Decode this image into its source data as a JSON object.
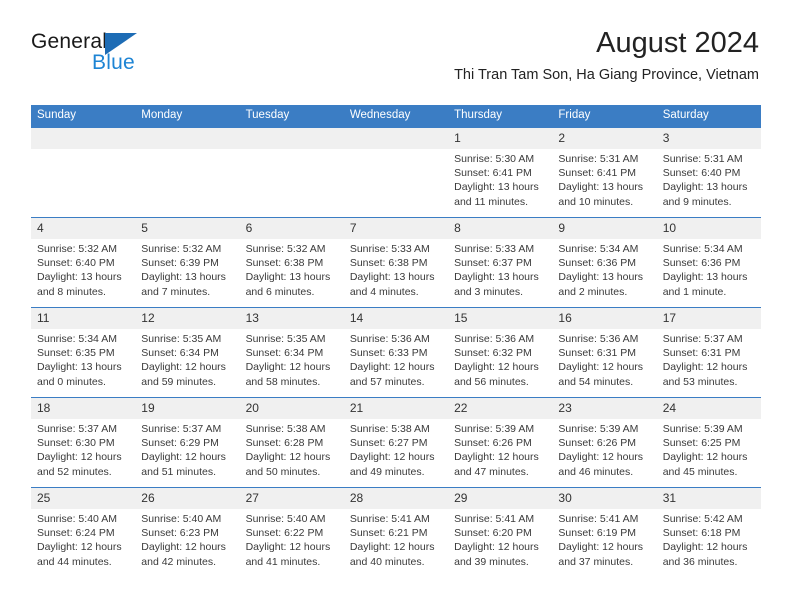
{
  "logo": {
    "primary_text": "General",
    "secondary_text": "Blue",
    "triangle_color": "#1d6cb5",
    "secondary_color": "#1d84d4"
  },
  "header": {
    "title": "August 2024",
    "subtitle": "Thi Tran Tam Son, Ha Giang Province, Vietnam"
  },
  "theme": {
    "header_bar_color": "#3b7dc4",
    "date_band_color": "#f0f0f0",
    "text_color": "#3a3a3a"
  },
  "weekdays": [
    "Sunday",
    "Monday",
    "Tuesday",
    "Wednesday",
    "Thursday",
    "Friday",
    "Saturday"
  ],
  "weeks": [
    [
      {
        "date": "",
        "empty": true,
        "sunrise": "",
        "sunset": "",
        "daylight_line1": "",
        "daylight_line2": ""
      },
      {
        "date": "",
        "empty": true,
        "sunrise": "",
        "sunset": "",
        "daylight_line1": "",
        "daylight_line2": ""
      },
      {
        "date": "",
        "empty": true,
        "sunrise": "",
        "sunset": "",
        "daylight_line1": "",
        "daylight_line2": ""
      },
      {
        "date": "",
        "empty": true,
        "sunrise": "",
        "sunset": "",
        "daylight_line1": "",
        "daylight_line2": ""
      },
      {
        "date": "1",
        "empty": false,
        "sunrise": "Sunrise: 5:30 AM",
        "sunset": "Sunset: 6:41 PM",
        "daylight_line1": "Daylight: 13 hours",
        "daylight_line2": "and 11 minutes."
      },
      {
        "date": "2",
        "empty": false,
        "sunrise": "Sunrise: 5:31 AM",
        "sunset": "Sunset: 6:41 PM",
        "daylight_line1": "Daylight: 13 hours",
        "daylight_line2": "and 10 minutes."
      },
      {
        "date": "3",
        "empty": false,
        "sunrise": "Sunrise: 5:31 AM",
        "sunset": "Sunset: 6:40 PM",
        "daylight_line1": "Daylight: 13 hours",
        "daylight_line2": "and 9 minutes."
      }
    ],
    [
      {
        "date": "4",
        "empty": false,
        "sunrise": "Sunrise: 5:32 AM",
        "sunset": "Sunset: 6:40 PM",
        "daylight_line1": "Daylight: 13 hours",
        "daylight_line2": "and 8 minutes."
      },
      {
        "date": "5",
        "empty": false,
        "sunrise": "Sunrise: 5:32 AM",
        "sunset": "Sunset: 6:39 PM",
        "daylight_line1": "Daylight: 13 hours",
        "daylight_line2": "and 7 minutes."
      },
      {
        "date": "6",
        "empty": false,
        "sunrise": "Sunrise: 5:32 AM",
        "sunset": "Sunset: 6:38 PM",
        "daylight_line1": "Daylight: 13 hours",
        "daylight_line2": "and 6 minutes."
      },
      {
        "date": "7",
        "empty": false,
        "sunrise": "Sunrise: 5:33 AM",
        "sunset": "Sunset: 6:38 PM",
        "daylight_line1": "Daylight: 13 hours",
        "daylight_line2": "and 4 minutes."
      },
      {
        "date": "8",
        "empty": false,
        "sunrise": "Sunrise: 5:33 AM",
        "sunset": "Sunset: 6:37 PM",
        "daylight_line1": "Daylight: 13 hours",
        "daylight_line2": "and 3 minutes."
      },
      {
        "date": "9",
        "empty": false,
        "sunrise": "Sunrise: 5:34 AM",
        "sunset": "Sunset: 6:36 PM",
        "daylight_line1": "Daylight: 13 hours",
        "daylight_line2": "and 2 minutes."
      },
      {
        "date": "10",
        "empty": false,
        "sunrise": "Sunrise: 5:34 AM",
        "sunset": "Sunset: 6:36 PM",
        "daylight_line1": "Daylight: 13 hours",
        "daylight_line2": "and 1 minute."
      }
    ],
    [
      {
        "date": "11",
        "empty": false,
        "sunrise": "Sunrise: 5:34 AM",
        "sunset": "Sunset: 6:35 PM",
        "daylight_line1": "Daylight: 13 hours",
        "daylight_line2": "and 0 minutes."
      },
      {
        "date": "12",
        "empty": false,
        "sunrise": "Sunrise: 5:35 AM",
        "sunset": "Sunset: 6:34 PM",
        "daylight_line1": "Daylight: 12 hours",
        "daylight_line2": "and 59 minutes."
      },
      {
        "date": "13",
        "empty": false,
        "sunrise": "Sunrise: 5:35 AM",
        "sunset": "Sunset: 6:34 PM",
        "daylight_line1": "Daylight: 12 hours",
        "daylight_line2": "and 58 minutes."
      },
      {
        "date": "14",
        "empty": false,
        "sunrise": "Sunrise: 5:36 AM",
        "sunset": "Sunset: 6:33 PM",
        "daylight_line1": "Daylight: 12 hours",
        "daylight_line2": "and 57 minutes."
      },
      {
        "date": "15",
        "empty": false,
        "sunrise": "Sunrise: 5:36 AM",
        "sunset": "Sunset: 6:32 PM",
        "daylight_line1": "Daylight: 12 hours",
        "daylight_line2": "and 56 minutes."
      },
      {
        "date": "16",
        "empty": false,
        "sunrise": "Sunrise: 5:36 AM",
        "sunset": "Sunset: 6:31 PM",
        "daylight_line1": "Daylight: 12 hours",
        "daylight_line2": "and 54 minutes."
      },
      {
        "date": "17",
        "empty": false,
        "sunrise": "Sunrise: 5:37 AM",
        "sunset": "Sunset: 6:31 PM",
        "daylight_line1": "Daylight: 12 hours",
        "daylight_line2": "and 53 minutes."
      }
    ],
    [
      {
        "date": "18",
        "empty": false,
        "sunrise": "Sunrise: 5:37 AM",
        "sunset": "Sunset: 6:30 PM",
        "daylight_line1": "Daylight: 12 hours",
        "daylight_line2": "and 52 minutes."
      },
      {
        "date": "19",
        "empty": false,
        "sunrise": "Sunrise: 5:37 AM",
        "sunset": "Sunset: 6:29 PM",
        "daylight_line1": "Daylight: 12 hours",
        "daylight_line2": "and 51 minutes."
      },
      {
        "date": "20",
        "empty": false,
        "sunrise": "Sunrise: 5:38 AM",
        "sunset": "Sunset: 6:28 PM",
        "daylight_line1": "Daylight: 12 hours",
        "daylight_line2": "and 50 minutes."
      },
      {
        "date": "21",
        "empty": false,
        "sunrise": "Sunrise: 5:38 AM",
        "sunset": "Sunset: 6:27 PM",
        "daylight_line1": "Daylight: 12 hours",
        "daylight_line2": "and 49 minutes."
      },
      {
        "date": "22",
        "empty": false,
        "sunrise": "Sunrise: 5:39 AM",
        "sunset": "Sunset: 6:26 PM",
        "daylight_line1": "Daylight: 12 hours",
        "daylight_line2": "and 47 minutes."
      },
      {
        "date": "23",
        "empty": false,
        "sunrise": "Sunrise: 5:39 AM",
        "sunset": "Sunset: 6:26 PM",
        "daylight_line1": "Daylight: 12 hours",
        "daylight_line2": "and 46 minutes."
      },
      {
        "date": "24",
        "empty": false,
        "sunrise": "Sunrise: 5:39 AM",
        "sunset": "Sunset: 6:25 PM",
        "daylight_line1": "Daylight: 12 hours",
        "daylight_line2": "and 45 minutes."
      }
    ],
    [
      {
        "date": "25",
        "empty": false,
        "sunrise": "Sunrise: 5:40 AM",
        "sunset": "Sunset: 6:24 PM",
        "daylight_line1": "Daylight: 12 hours",
        "daylight_line2": "and 44 minutes."
      },
      {
        "date": "26",
        "empty": false,
        "sunrise": "Sunrise: 5:40 AM",
        "sunset": "Sunset: 6:23 PM",
        "daylight_line1": "Daylight: 12 hours",
        "daylight_line2": "and 42 minutes."
      },
      {
        "date": "27",
        "empty": false,
        "sunrise": "Sunrise: 5:40 AM",
        "sunset": "Sunset: 6:22 PM",
        "daylight_line1": "Daylight: 12 hours",
        "daylight_line2": "and 41 minutes."
      },
      {
        "date": "28",
        "empty": false,
        "sunrise": "Sunrise: 5:41 AM",
        "sunset": "Sunset: 6:21 PM",
        "daylight_line1": "Daylight: 12 hours",
        "daylight_line2": "and 40 minutes."
      },
      {
        "date": "29",
        "empty": false,
        "sunrise": "Sunrise: 5:41 AM",
        "sunset": "Sunset: 6:20 PM",
        "daylight_line1": "Daylight: 12 hours",
        "daylight_line2": "and 39 minutes."
      },
      {
        "date": "30",
        "empty": false,
        "sunrise": "Sunrise: 5:41 AM",
        "sunset": "Sunset: 6:19 PM",
        "daylight_line1": "Daylight: 12 hours",
        "daylight_line2": "and 37 minutes."
      },
      {
        "date": "31",
        "empty": false,
        "sunrise": "Sunrise: 5:42 AM",
        "sunset": "Sunset: 6:18 PM",
        "daylight_line1": "Daylight: 12 hours",
        "daylight_line2": "and 36 minutes."
      }
    ]
  ]
}
